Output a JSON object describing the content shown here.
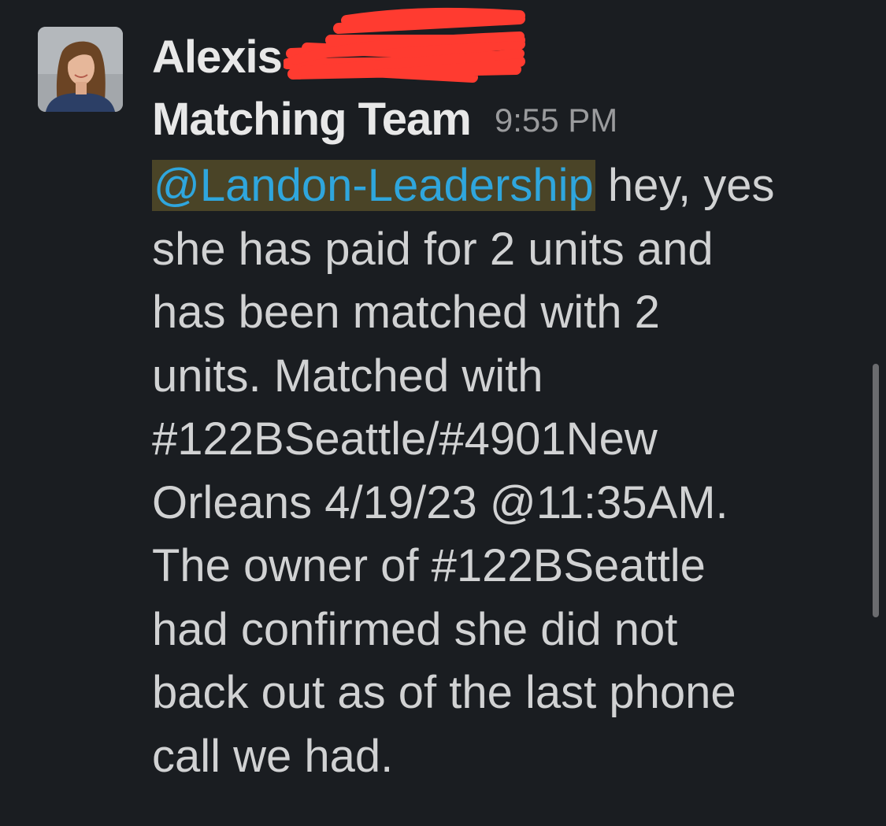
{
  "message": {
    "sender_name": "Alexis",
    "sender_team": "Matching Team",
    "timestamp": "9:55 PM",
    "mention": "@Landon-Leadership",
    "text": " hey,  yes\nshe has paid for 2 units and\nhas been matched with 2\nunits.  Matched with\n#122BSeattle/#4901New\nOrleans 4/19/23 @11:35AM.\nThe owner of #122BSeattle\nhad confirmed she did not\nback out as of the last phone\ncall we had."
  },
  "colors": {
    "background": "#1a1d21",
    "mention_text": "#2fa6dd",
    "mention_highlight": "#4a4427",
    "redaction": "#ff3b30"
  },
  "icons": {
    "avatar": "avatar-photo",
    "redaction": "redaction-scribble"
  }
}
